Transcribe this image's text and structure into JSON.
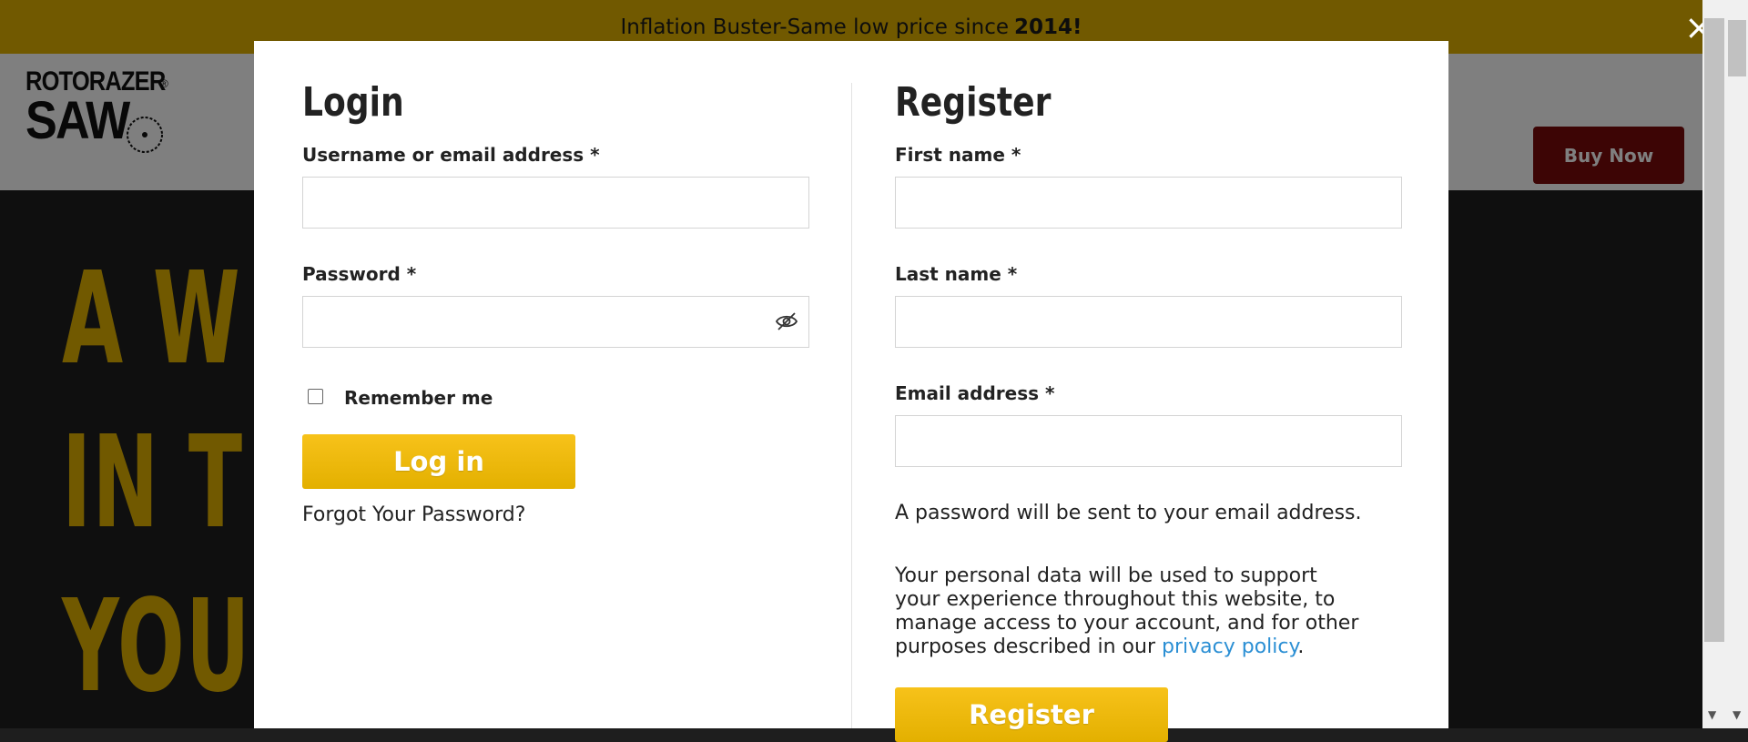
{
  "announcement": {
    "text": "Inflation Buster-Same low price since",
    "year": "2014!"
  },
  "logo": {
    "line1": "ROTORAZER",
    "line2": "SAW",
    "registered": "®"
  },
  "header": {
    "buy_now_label": "Buy Now"
  },
  "hero": {
    "lines": [
      "A W",
      "IN T",
      "YOU"
    ]
  },
  "modal": {
    "close_label": "×",
    "login": {
      "title": "Login",
      "username_label": "Username or email address *",
      "username_value": "",
      "password_label": "Password *",
      "password_value": "",
      "remember_label": "Remember me",
      "remember_checked": false,
      "login_button": "Log in",
      "forgot_link": "Forgot Your Password?"
    },
    "register": {
      "title": "Register",
      "first_name_label": "First name *",
      "last_name_label": "Last name *",
      "email_label": "Email address *",
      "password_note": "A password will be sent to your email address.",
      "privacy_text": "Your personal data will be used to support your experience throughout this website, to manage access to your account, and for other purposes described in our",
      "privacy_link": "privacy policy",
      "privacy_end": ".",
      "register_button": "Register"
    }
  },
  "colors": {
    "brand_yellow": "#e3b300",
    "buy_now_red": "#7a0a0a",
    "link_blue": "#2b8fd4"
  }
}
